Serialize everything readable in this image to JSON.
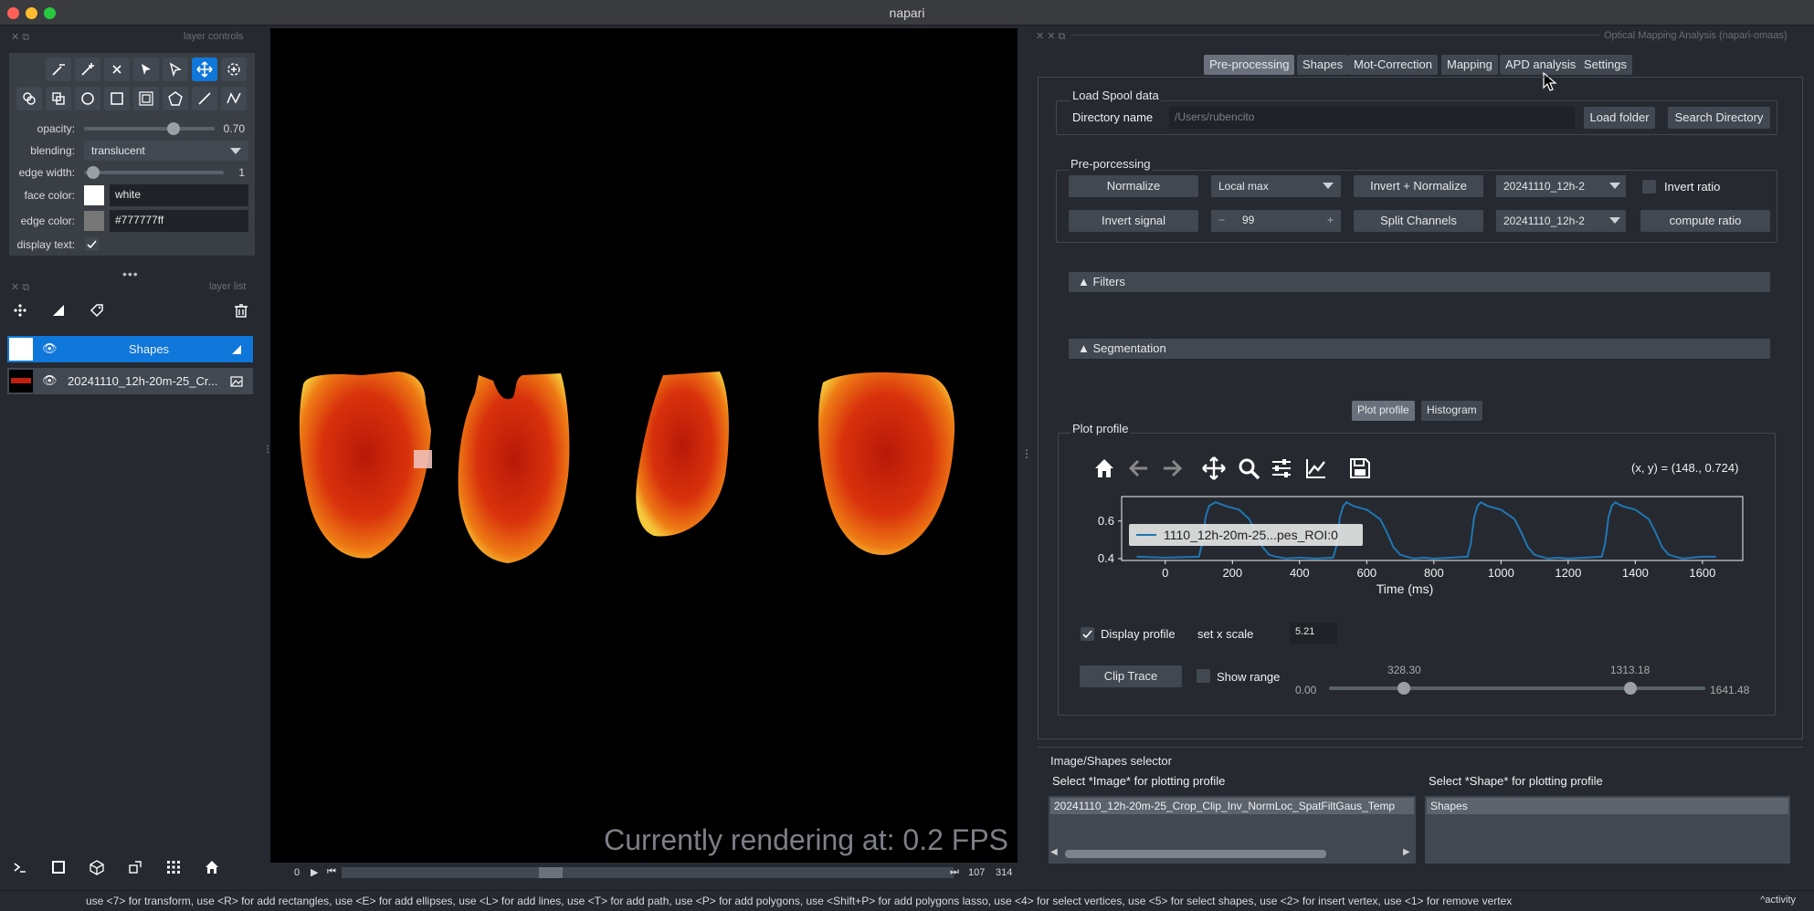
{
  "window": {
    "title": "napari"
  },
  "left_dock": {
    "layer_controls_title": "layer controls",
    "opacity_label": "opacity:",
    "opacity_value": "0.70",
    "blending_label": "blending:",
    "blending_value": "translucent",
    "edge_width_label": "edge width:",
    "edge_width_value": "1",
    "face_color_label": "face color:",
    "face_color_value": "white",
    "edge_color_label": "edge color:",
    "edge_color_value": "#777777ff",
    "display_text_label": "display text:",
    "layer_list_title": "layer list",
    "layers": [
      {
        "name": "Shapes"
      },
      {
        "name": "20241110_12h-20m-25_Cr..."
      }
    ]
  },
  "viewer": {
    "fps_text": "Currently rendering at: 0.2 FPS",
    "slider_start": "0",
    "slider_pos": "107",
    "slider_end": "314"
  },
  "right_dock": {
    "title": "Optical Mapping Analysis (napari-omaas)",
    "tabs": [
      "Pre-processing",
      "Shapes",
      "Mot-Correction",
      "Mapping",
      "APD analysis",
      "Settings"
    ],
    "load_group_title": "Load Spool data",
    "dir_label": "Directory name",
    "dir_placeholder": "/Users/rubencito",
    "load_folder": "Load folder",
    "search_dir": "Search Directory",
    "preproc_title": "Pre-porcessing",
    "normalize": "Normalize",
    "local_max": "Local max",
    "invert_normalize": "Invert + Normalize",
    "combo1": "20241110_12h-2",
    "invert_ratio": "Invert ratio",
    "invert_signal": "Invert signal",
    "spin_minus": "−",
    "spin_value": "99",
    "spin_plus": "+",
    "split_channels": "Split Channels",
    "combo2": "20241110_12h-2",
    "compute_ratio": "compute ratio",
    "filters": "▲ Filters",
    "segmentation": "▲ Segmentation",
    "subtabs": [
      "Plot profile",
      "Histogram"
    ],
    "plot_profile_title": "Plot profile",
    "coord_readout": "(x, y) = (148., 0.724)",
    "display_profile": "Display profile",
    "set_x_scale": "set x scale",
    "x_scale_value": "5.21",
    "clip_trace": "Clip Trace",
    "show_range": "Show range",
    "range_min": "0.00",
    "range_max": "1641.48",
    "range_low": "328.30",
    "range_high": "1313.18",
    "range_low_frac": 0.2,
    "range_high_frac": 0.8,
    "selector_title": "Image/Shapes selector",
    "select_image_label": "Select *Image* for plotting profile",
    "select_shape_label": "Select *Shape* for plotting profile",
    "image_item": "20241110_12h-20m-25_Crop_Clip_Inv_NormLoc_SpatFiltGaus_Temp",
    "shape_item": "Shapes"
  },
  "status_bar": {
    "text": "use <7> for transform, use <R> for add rectangles, use <E> for add ellipses, use <L> for add lines, use <T> for add path, use <P> for add polygons, use <Shift+P> for add polygons lasso, use <4> for select vertices, use <5> for select shapes, use <2> for insert vertex, use <1> for remove vertex",
    "activity": "^activity"
  },
  "chart_data": {
    "type": "line",
    "xlabel": "Time (ms)",
    "ylabel": "",
    "xlim": [
      -130,
      1720
    ],
    "ylim": [
      0.39,
      0.73
    ],
    "xticks": [
      0,
      200,
      400,
      600,
      800,
      1000,
      1200,
      1400,
      1600
    ],
    "yticks": [
      0.4,
      0.6
    ],
    "legend": "top-left",
    "series": [
      {
        "name": "1110_12h-20m-25...pes_ROI:0",
        "color": "#1f77b4",
        "x": [
          -85,
          0,
          100,
          110,
          120,
          130,
          150,
          180,
          220,
          250,
          270,
          290,
          310,
          330,
          360,
          400,
          450,
          500,
          510,
          520,
          530,
          540,
          560,
          600,
          640,
          660,
          680,
          700,
          720,
          740,
          770,
          800,
          850,
          900,
          910,
          920,
          930,
          940,
          960,
          1000,
          1040,
          1060,
          1080,
          1100,
          1120,
          1140,
          1170,
          1200,
          1250,
          1300,
          1310,
          1320,
          1330,
          1340,
          1360,
          1400,
          1440,
          1460,
          1480,
          1500,
          1520,
          1540,
          1570,
          1600,
          1640
        ],
        "y": [
          0.41,
          0.405,
          0.41,
          0.48,
          0.62,
          0.68,
          0.7,
          0.68,
          0.66,
          0.61,
          0.54,
          0.46,
          0.42,
          0.41,
          0.4,
          0.405,
          0.4,
          0.405,
          0.47,
          0.62,
          0.68,
          0.7,
          0.68,
          0.66,
          0.61,
          0.54,
          0.46,
          0.42,
          0.41,
          0.4,
          0.405,
          0.4,
          0.405,
          0.41,
          0.48,
          0.62,
          0.68,
          0.7,
          0.68,
          0.66,
          0.61,
          0.54,
          0.46,
          0.42,
          0.41,
          0.4,
          0.405,
          0.4,
          0.405,
          0.41,
          0.48,
          0.62,
          0.68,
          0.7,
          0.68,
          0.66,
          0.61,
          0.54,
          0.46,
          0.42,
          0.41,
          0.4,
          0.405,
          0.41,
          0.41
        ]
      }
    ]
  },
  "colors": {
    "accent": "#0f77d9",
    "panel": "#262930",
    "button": "#414851",
    "heat": "#d12a10"
  }
}
